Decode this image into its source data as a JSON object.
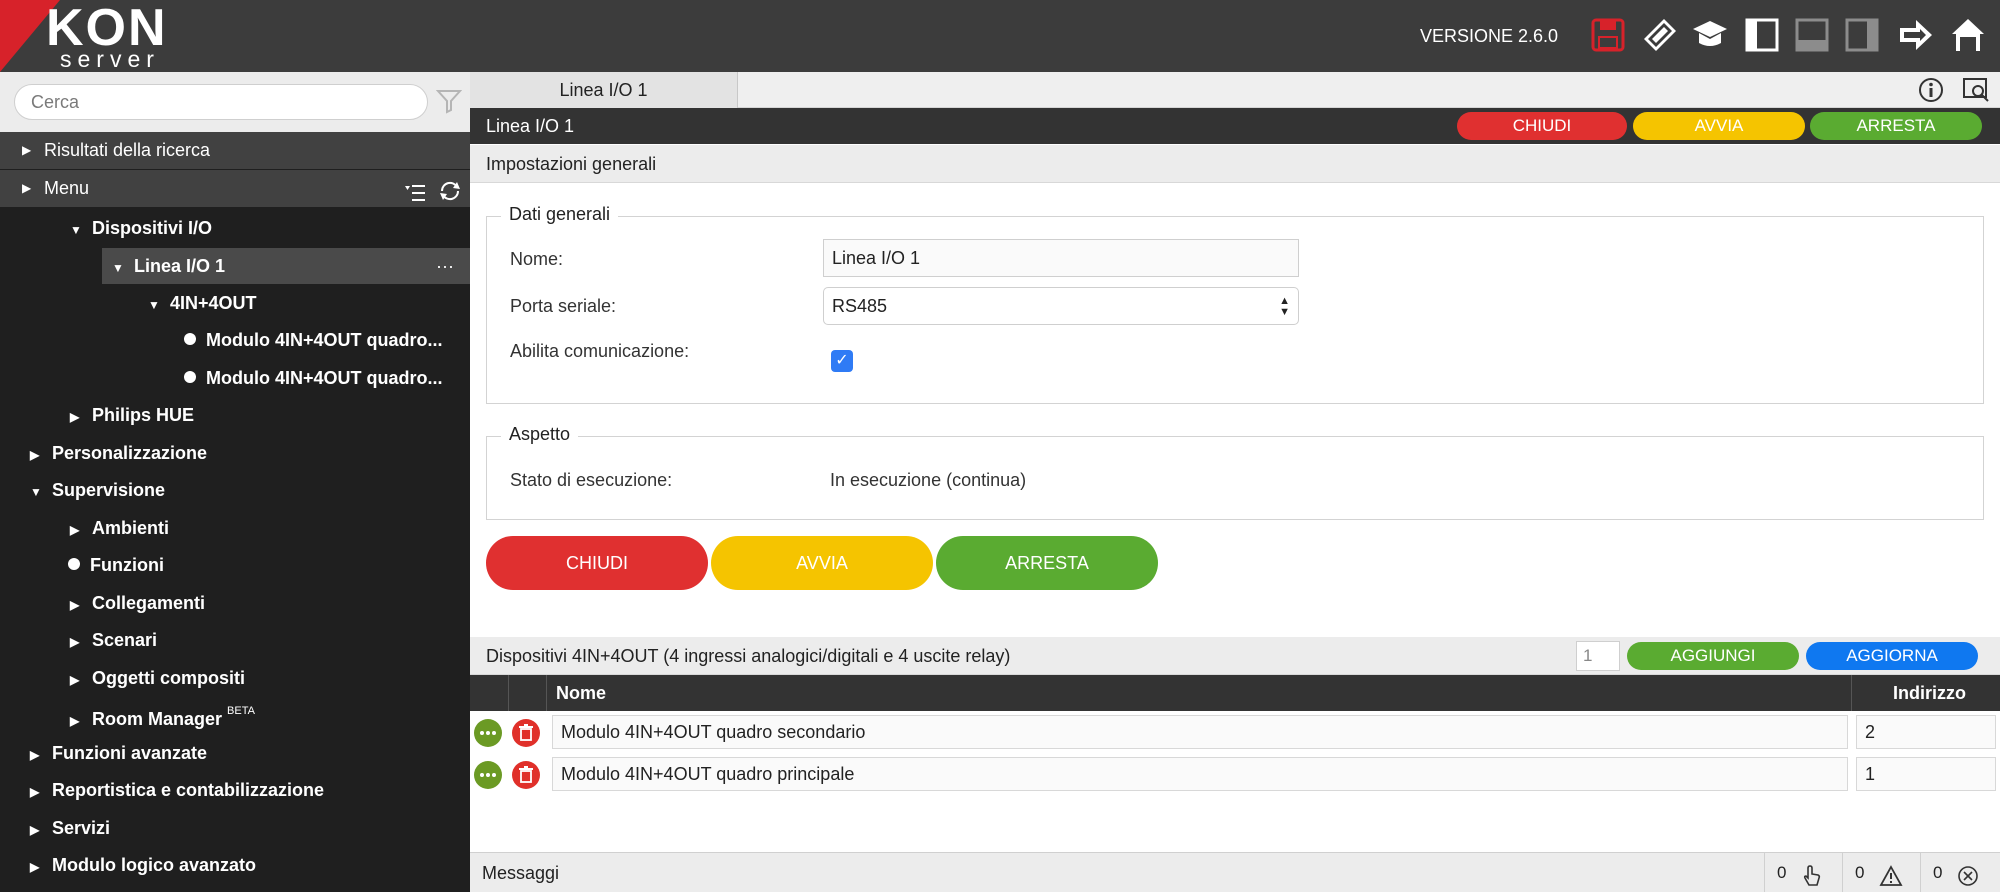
{
  "app": {
    "logo_text": "KON",
    "logo_sub": "server",
    "version": "VERSIONE 2.6.0"
  },
  "toolbar_icons": [
    "save-icon",
    "brush-icon",
    "graduation-cap-icon",
    "layout-left-icon",
    "layout-bottom-icon",
    "layout-right-icon",
    "exit-arrow-icon",
    "home-icon"
  ],
  "sidebar": {
    "search_placeholder": "Cerca",
    "results_header": "Risultati della ricerca",
    "menu_header": "Menu",
    "tree": [
      {
        "label": "Dispositivi I/O",
        "marker": "▼"
      },
      {
        "label": "Linea I/O 1",
        "marker": "▼"
      },
      {
        "label": "4IN+4OUT",
        "marker": "▼"
      },
      {
        "label": "Modulo 4IN+4OUT quadro...",
        "marker": "dot"
      },
      {
        "label": "Modulo 4IN+4OUT quadro...",
        "marker": "dot"
      },
      {
        "label": "Philips HUE",
        "marker": "▶"
      },
      {
        "label": "Personalizzazione",
        "marker": "▶"
      },
      {
        "label": "Supervisione",
        "marker": "▼"
      },
      {
        "label": "Ambienti",
        "marker": "▶"
      },
      {
        "label": "Funzioni",
        "marker": "dot"
      },
      {
        "label": "Collegamenti",
        "marker": "▶"
      },
      {
        "label": "Scenari",
        "marker": "▶"
      },
      {
        "label": "Oggetti compositi",
        "marker": "▶"
      },
      {
        "label": "Room Manager",
        "marker": "▶",
        "sup": "BETA"
      },
      {
        "label": "Funzioni avanzate",
        "marker": "▶"
      },
      {
        "label": "Reportistica e contabilizzazione",
        "marker": "▶"
      },
      {
        "label": "Servizi",
        "marker": "▶"
      },
      {
        "label": "Modulo logico avanzato",
        "marker": "▶"
      }
    ],
    "more_label": "···"
  },
  "tabs": [
    {
      "label": "Linea I/O 1"
    }
  ],
  "panel": {
    "title": "Linea I/O 1",
    "buttons": {
      "close": "CHIUDI",
      "start": "AVVIA",
      "stop": "ARRESTA"
    }
  },
  "general": {
    "section_title": "Impostazioni generali",
    "data_legend": "Dati generali",
    "name_label": "Nome:",
    "name_value": "Linea I/O 1",
    "port_label": "Porta seriale:",
    "port_value": "RS485",
    "enable_label": "Abilita comunicazione:",
    "enable_checked": true,
    "aspect_legend": "Aspetto",
    "state_label": "Stato di esecuzione:",
    "state_value": "In esecuzione (continua)"
  },
  "big_buttons": {
    "close": "CHIUDI",
    "start": "AVVIA",
    "stop": "ARRESTA"
  },
  "devices": {
    "title": "Dispositivi 4IN+4OUT (4 ingressi analogici/digitali e 4 uscite relay)",
    "quantity": "1",
    "add_label": "AGGIUNGI",
    "refresh_label": "AGGIORNA",
    "columns": {
      "name": "Nome",
      "address": "Indirizzo"
    },
    "rows": [
      {
        "name": "Modulo 4IN+4OUT quadro secondario",
        "address": "2"
      },
      {
        "name": "Modulo 4IN+4OUT quadro principale",
        "address": "1"
      }
    ]
  },
  "messages": {
    "label": "Messaggi",
    "counters": [
      {
        "count": "0",
        "icon": "hand-pointer-icon"
      },
      {
        "count": "0",
        "icon": "warning-icon"
      },
      {
        "count": "0",
        "icon": "error-circle-icon"
      }
    ]
  },
  "colors": {
    "accent_red": "#d7222a",
    "button_red": "#e03030",
    "button_yellow": "#f5c400",
    "button_green": "#5aab31",
    "button_blue": "#0f78f0"
  }
}
